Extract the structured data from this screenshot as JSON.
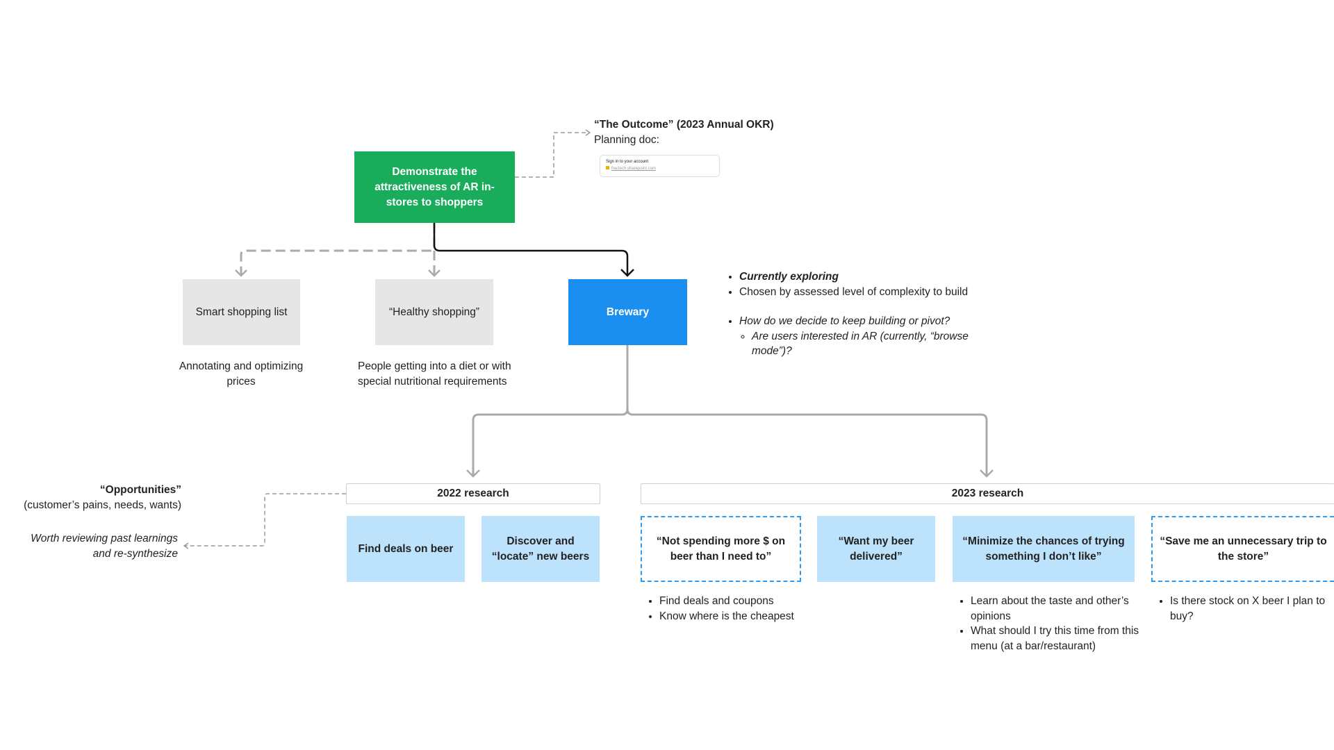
{
  "okr": {
    "title": "“The Outcome” (2023 Annual OKR)",
    "planning_label": "Planning doc:",
    "doc_card": {
      "title": "Sign in to your account",
      "link": "fractech.sharepoint.com"
    }
  },
  "goal": "Demonstrate the attractiveness of AR in-stores to shoppers",
  "options": [
    {
      "label": "Smart shopping list",
      "caption": "Annotating and optimizing prices"
    },
    {
      "label": "“Healthy shopping”",
      "caption": "People getting into a diet or with special nutritional requirements"
    },
    {
      "label": "Brewary"
    }
  ],
  "notes": {
    "status": "Currently exploring",
    "reason": "Chosen by assessed level of complexity to build",
    "question": "How do we decide to keep building or pivot?",
    "sub_question": "Are users interested in AR (currently, “browse mode”)?"
  },
  "opportunities": {
    "title": "“Opportunities”",
    "subtitle": "(customer’s pains, needs, wants)",
    "note": "Worth reviewing past learnings and re-synthesize"
  },
  "research_2022": {
    "label": "2022 research",
    "cards": [
      "Find deals on beer",
      "Discover and “locate” new beers"
    ]
  },
  "research_2023": {
    "label": "2023 research",
    "cards": [
      {
        "label": "“Not spending more $ on beer than I need to”",
        "bullets": [
          "Find deals and coupons",
          "Know where is the cheapest"
        ]
      },
      {
        "label": "“Want my beer delivered”"
      },
      {
        "label": "“Minimize the chances of trying something I don’t like”",
        "bullets": [
          "Learn about the taste and other’s opinions",
          "What should I try this time from this menu (at a bar/restaurant)"
        ]
      },
      {
        "label": "“Save me an unnecessary trip to the store”",
        "bullets": [
          "Is there stock on X beer I plan to buy?"
        ]
      }
    ]
  },
  "colors": {
    "goal": "#19ad5b",
    "selected": "#1a8ff0",
    "opportunity": "#bde2fb",
    "dashed_opportunity": "#2b9af3",
    "option": "#e6e6e6"
  }
}
